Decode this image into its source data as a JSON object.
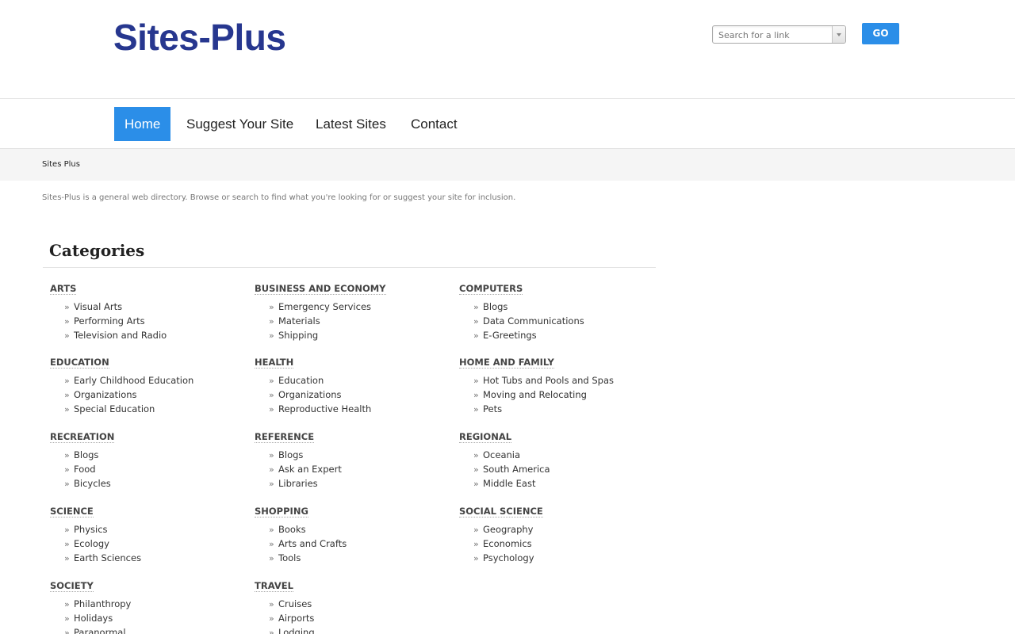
{
  "header": {
    "logo_text": "Sites-Plus",
    "search_placeholder": "Search for a link",
    "go_label": "GO"
  },
  "nav": {
    "items": [
      "Home",
      "Suggest Your Site",
      "Latest Sites",
      "Contact"
    ],
    "active": "Home"
  },
  "breadcrumb": "Sites Plus",
  "intro": "Sites-Plus is a general web directory. Browse or search to find what you're looking for or suggest your site for inclusion.",
  "categories_heading": "Categories",
  "categories": [
    {
      "title": "ARTS",
      "items": [
        "Visual Arts",
        "Performing Arts",
        "Television and Radio"
      ]
    },
    {
      "title": "BUSINESS AND ECONOMY",
      "items": [
        "Emergency Services",
        "Materials",
        "Shipping"
      ]
    },
    {
      "title": "COMPUTERS",
      "items": [
        "Blogs",
        "Data Communications",
        "E-Greetings"
      ]
    },
    {
      "title": "EDUCATION",
      "items": [
        "Early Childhood Education",
        "Organizations",
        "Special Education"
      ]
    },
    {
      "title": "HEALTH",
      "items": [
        "Education",
        "Organizations",
        "Reproductive Health"
      ]
    },
    {
      "title": "HOME AND FAMILY",
      "items": [
        "Hot Tubs and Pools and Spas",
        "Moving and Relocating",
        "Pets"
      ]
    },
    {
      "title": "RECREATION",
      "items": [
        "Blogs",
        "Food",
        "Bicycles"
      ]
    },
    {
      "title": "REFERENCE",
      "items": [
        "Blogs",
        "Ask an Expert",
        "Libraries"
      ]
    },
    {
      "title": "REGIONAL",
      "items": [
        "Oceania",
        "South America",
        "Middle East"
      ]
    },
    {
      "title": "SCIENCE",
      "items": [
        "Physics",
        "Ecology",
        "Earth Sciences"
      ]
    },
    {
      "title": "SHOPPING",
      "items": [
        "Books",
        "Arts and Crafts",
        "Tools"
      ]
    },
    {
      "title": "SOCIAL SCIENCE",
      "items": [
        "Geography",
        "Economics",
        "Psychology"
      ]
    },
    {
      "title": "SOCIETY",
      "items": [
        "Philanthropy",
        "Holidays",
        "Paranormal"
      ]
    },
    {
      "title": "TRAVEL",
      "items": [
        "Cruises",
        "Airports",
        "Lodging"
      ]
    }
  ],
  "icons": {
    "list_bullet": "raquo-icon",
    "search_dropdown": "chevron-down-icon"
  },
  "colors": {
    "brand": "#27378f",
    "accent": "#2b8ee8"
  }
}
